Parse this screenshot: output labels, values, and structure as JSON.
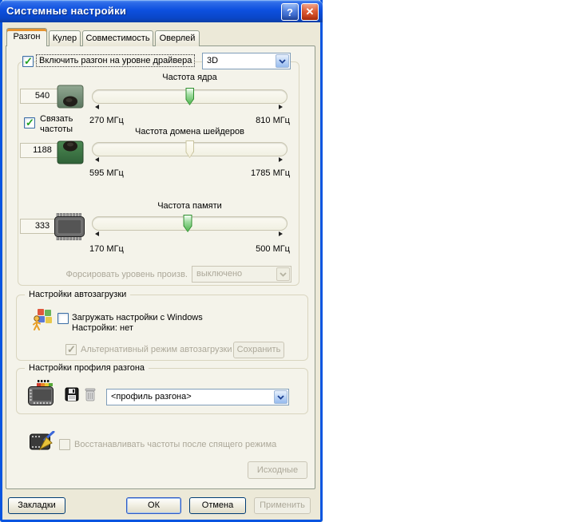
{
  "window": {
    "title": "Системные настройки",
    "help_label": "?",
    "close_label": "✕"
  },
  "tabs": [
    {
      "label": "Разгон"
    },
    {
      "label": "Кулер"
    },
    {
      "label": "Совместимость"
    },
    {
      "label": "Оверлей"
    }
  ],
  "overclock": {
    "enable_label": "Включить разгон на уровне драйвера",
    "mode_value": "3D",
    "link_line1": "Связать",
    "link_line2": "частоты",
    "sliders": [
      {
        "title": "Частота ядра",
        "value": "540",
        "min_label": "270 МГц",
        "max_label": "810 МГц",
        "percent": 50
      },
      {
        "title": "Частота домена шейдеров",
        "value": "1188",
        "min_label": "595 МГц",
        "max_label": "1785 МГц",
        "percent": 50
      },
      {
        "title": "Частота памяти",
        "value": "333",
        "min_label": "170 МГц",
        "max_label": "500 МГц",
        "percent": 49
      }
    ],
    "force_label": "Форсировать уровень произв.",
    "force_value": "выключено"
  },
  "autoload": {
    "title": "Настройки автозагрузки",
    "load_checkbox_label": "Загружать настройки с Windows",
    "status_line": "Настройки: нет",
    "alt_checkbox_label": "Альтернативный режим автозагрузки",
    "save_button": "Сохранить"
  },
  "profile": {
    "title": "Настройки профиля разгона",
    "combo_value": "<профиль разгона>"
  },
  "restore": {
    "checkbox_label": "Восстанавливать частоты после спящего режима",
    "defaults_button": "Исходные"
  },
  "footer": {
    "bookmarks": "Закладки",
    "ok": "ОК",
    "cancel": "Отмена",
    "apply": "Применить"
  },
  "colors": {
    "titlebar_blue": "#0D50DF",
    "frame_blue": "#0855E0",
    "dialog_bg": "#ECE9D8",
    "page_bg": "#F4F3EA",
    "check_green": "#21A121",
    "thumb_green": "#4FB44F",
    "tab_active_accent": "#E5932F",
    "disabled_text": "#ACA899"
  }
}
